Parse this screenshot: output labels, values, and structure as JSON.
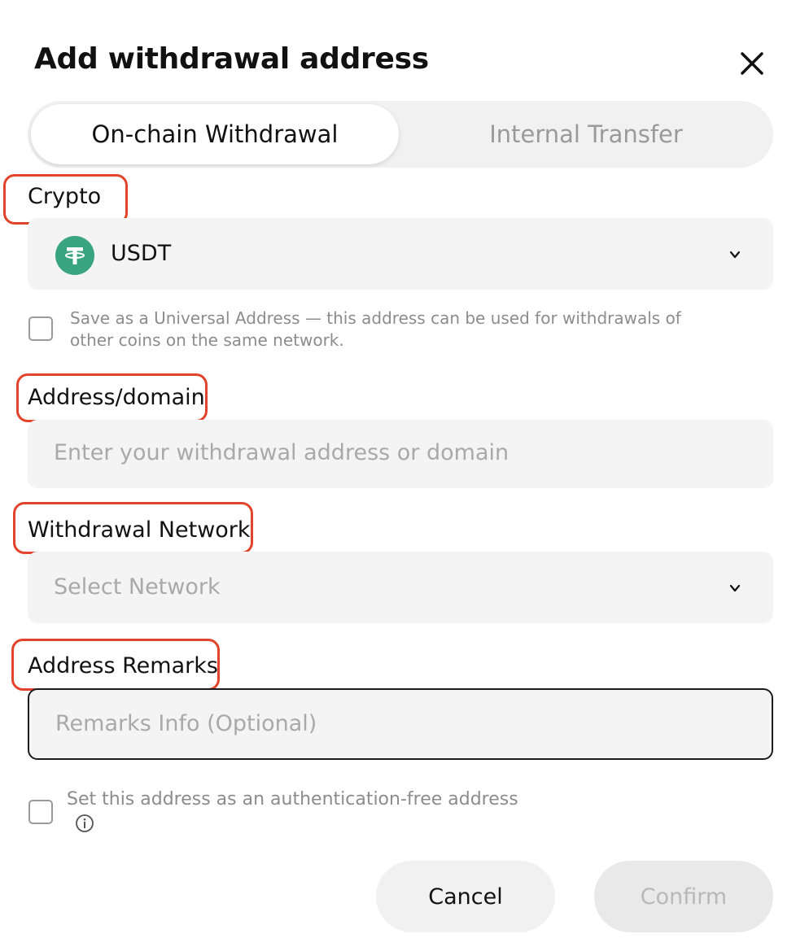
{
  "dialog": {
    "title": "Add withdrawal address"
  },
  "tabs": [
    {
      "label": "On-chain Withdrawal",
      "active": true
    },
    {
      "label": "Internal Transfer",
      "active": false
    }
  ],
  "crypto": {
    "label": "Crypto",
    "selected": "USDT",
    "icon": "tether-icon"
  },
  "universal": {
    "text": "Save as a Universal Address — this address can be used for withdrawals of other coins on the same network.",
    "checked": false
  },
  "address": {
    "label": "Address/domain",
    "placeholder": "Enter your withdrawal address or domain",
    "value": ""
  },
  "network": {
    "label": "Withdrawal Network",
    "placeholder": "Select Network"
  },
  "remarks": {
    "label": "Address Remarks",
    "placeholder": "Remarks Info (Optional)",
    "value": ""
  },
  "auth_free": {
    "text": "Set this address as an authentication-free address",
    "checked": false
  },
  "actions": {
    "cancel": "Cancel",
    "confirm": "Confirm"
  },
  "colors": {
    "highlight": "#e2432a",
    "tether": "#3aa37f"
  }
}
